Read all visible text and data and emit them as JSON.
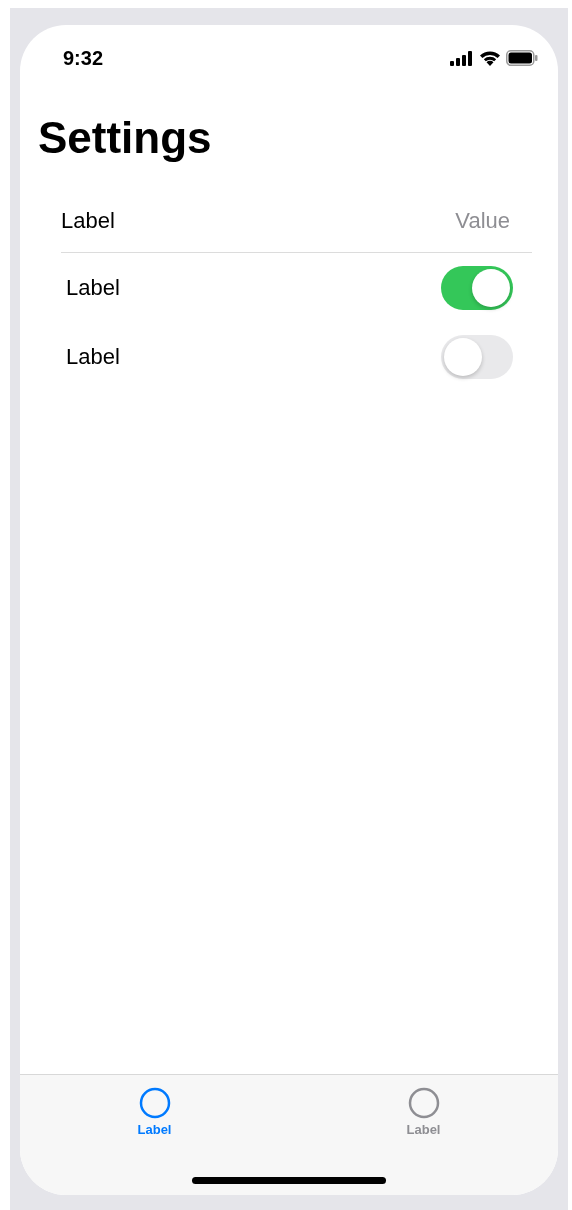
{
  "status_bar": {
    "time": "9:32"
  },
  "title": "Settings",
  "rows": [
    {
      "kind": "value",
      "label": "Label",
      "value": "Value"
    },
    {
      "kind": "toggle",
      "label": "Label",
      "on": true
    },
    {
      "kind": "toggle",
      "label": "Label",
      "on": false
    }
  ],
  "tab_bar": [
    {
      "label": "Label",
      "selected": true
    },
    {
      "label": "Label",
      "selected": false
    }
  ]
}
